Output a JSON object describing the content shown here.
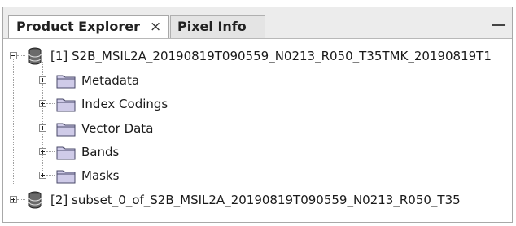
{
  "tabs": [
    {
      "label": "Product Explorer",
      "close_glyph": "×",
      "active": true
    },
    {
      "label": "Pixel Info",
      "active": false
    }
  ],
  "window_controls": {
    "minimize_glyph": "—"
  },
  "tree": {
    "products": [
      {
        "label": "[1] S2B_MSIL2A_20190819T090559_N0213_R050_T35TMK_20190819T1",
        "icon": "database-icon",
        "expanded": true,
        "children": [
          {
            "label": "Metadata",
            "icon": "folder-icon"
          },
          {
            "label": "Index Codings",
            "icon": "folder-icon"
          },
          {
            "label": "Vector Data",
            "icon": "folder-icon"
          },
          {
            "label": "Bands",
            "icon": "folder-icon"
          },
          {
            "label": "Masks",
            "icon": "folder-icon"
          }
        ]
      },
      {
        "label": "[2] subset_0_of_S2B_MSIL2A_20190819T090559_N0213_R050_T35",
        "icon": "database-icon",
        "expanded": false
      }
    ]
  },
  "colors": {
    "folder_fill": "#cfcbe8",
    "folder_stroke": "#4a4a6a",
    "tab_bg": "#ececec"
  }
}
